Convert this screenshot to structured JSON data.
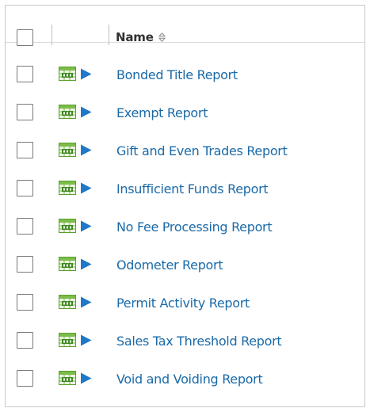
{
  "table": {
    "name_column_header": "Name",
    "sort_icon": "sort-updown-icon",
    "row_icons": {
      "report": "report-sheet-icon",
      "run": "play-triangle-icon"
    },
    "colors": {
      "link": "#1a6aa8",
      "icon_green": "#5aa02c",
      "play_blue": "#1f78c8"
    },
    "rows": [
      {
        "name": "Bonded Title Report"
      },
      {
        "name": "Exempt Report"
      },
      {
        "name": "Gift and Even Trades Report"
      },
      {
        "name": "Insufficient Funds Report"
      },
      {
        "name": "No Fee Processing Report"
      },
      {
        "name": "Odometer Report"
      },
      {
        "name": "Permit Activity Report"
      },
      {
        "name": "Sales Tax Threshold Report"
      },
      {
        "name": "Void and Voiding Report"
      }
    ]
  }
}
